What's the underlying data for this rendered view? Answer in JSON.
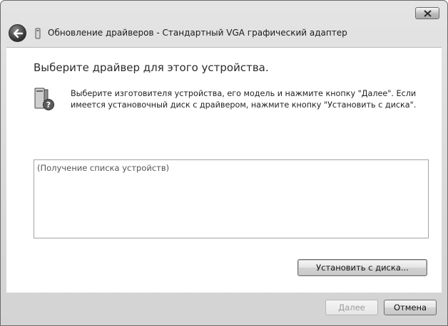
{
  "window": {
    "title": "Обновление драйверов - Стандартный VGA графический адаптер"
  },
  "main": {
    "heading": "Выберите драйвер для этого устройства.",
    "description": "Выберите изготовителя устройства, его модель и нажмите кнопку \"Далее\". Если имеется установочный диск с  драйвером, нажмите кнопку \"Установить с диска\".",
    "list_placeholder": "(Получение списка устройств)",
    "have_disk_label": "Установить с диска..."
  },
  "footer": {
    "next_label": "Далее",
    "cancel_label": "Отмена"
  }
}
